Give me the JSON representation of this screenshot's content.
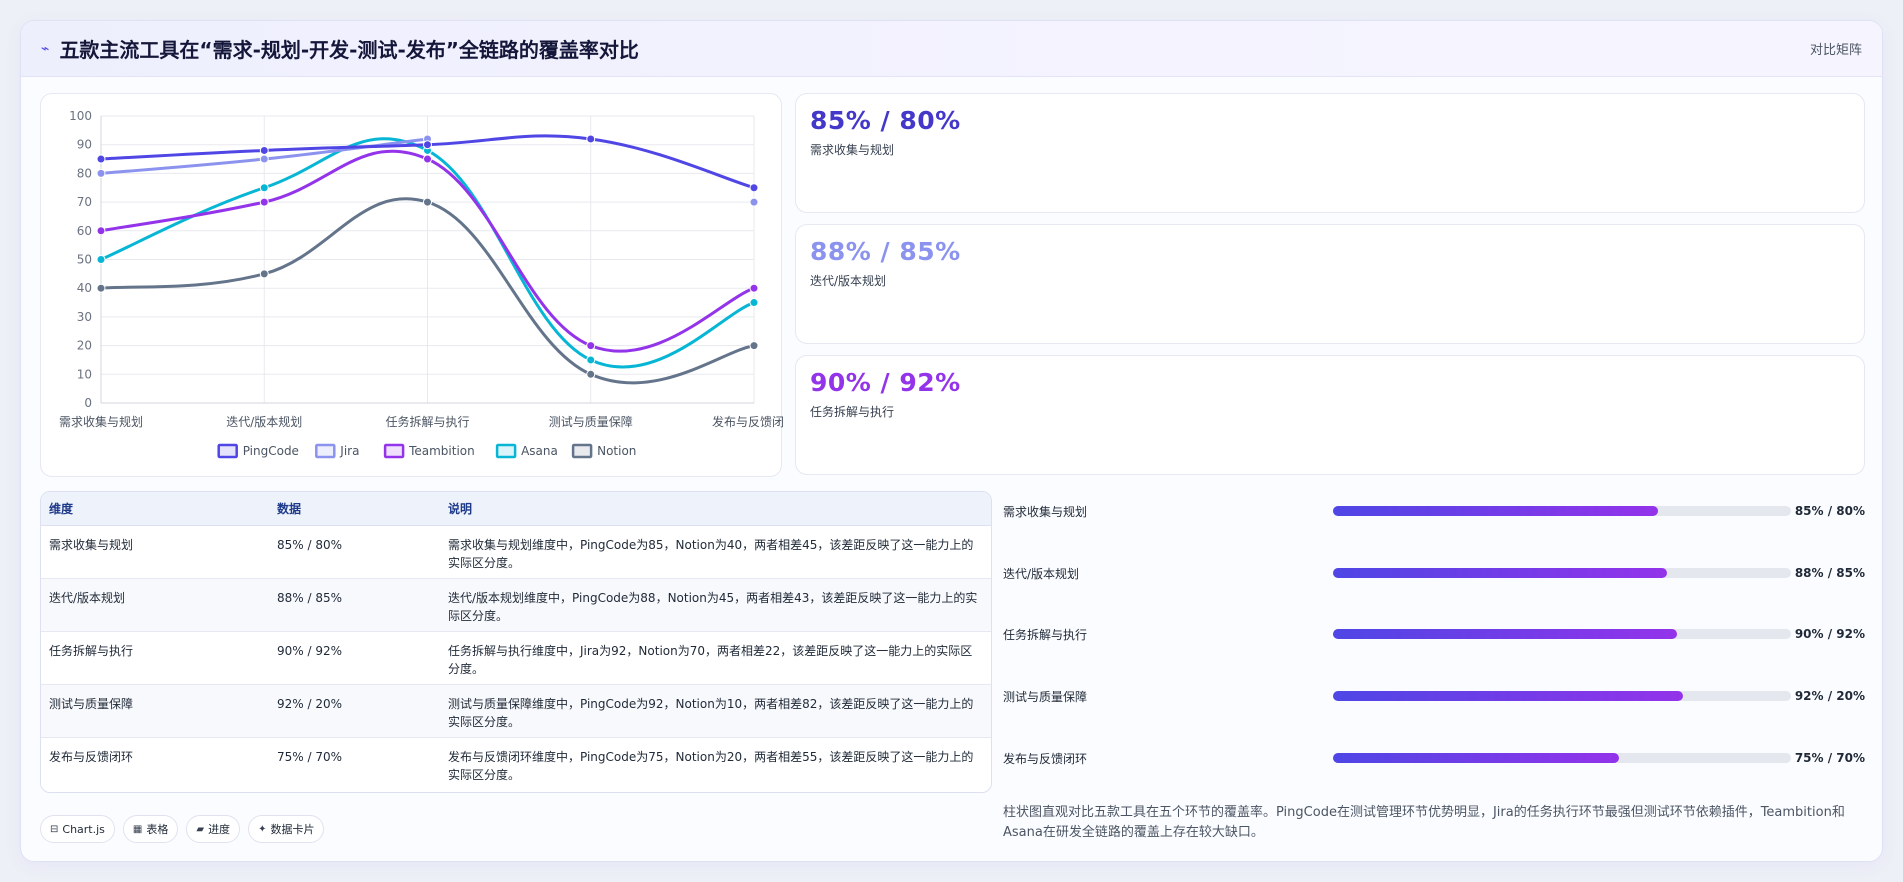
{
  "header": {
    "icon": "chart-line-icon",
    "title": "五款主流工具在“需求-规划-开发-测试-发布”全链路的覆盖率对比",
    "right_label": "对比矩阵"
  },
  "chart_data": {
    "type": "line",
    "categories": [
      "需求收集与规划",
      "迭代/版本规划",
      "任务拆解与执行",
      "测试与质量保障",
      "发布与反馈闭环"
    ],
    "series": [
      {
        "name": "PingCode",
        "values": [
          85,
          88,
          90,
          92,
          75
        ],
        "color": "#4f46e5"
      },
      {
        "name": "Jira",
        "values": [
          80,
          85,
          92,
          null,
          70
        ],
        "color": "#8b93ee"
      },
      {
        "name": "Teambition",
        "values": [
          60,
          70,
          85,
          20,
          40
        ],
        "color": "#9333ea"
      },
      {
        "name": "Asana",
        "values": [
          50,
          75,
          88,
          15,
          35
        ],
        "color": "#06b6d4"
      },
      {
        "name": "Notion",
        "values": [
          40,
          45,
          70,
          10,
          20
        ],
        "color": "#64748b"
      }
    ],
    "ylim": [
      0,
      100
    ],
    "yticks": [
      0,
      10,
      20,
      30,
      40,
      50,
      60,
      70,
      80,
      90,
      100
    ],
    "grid": true,
    "legend": "bottom"
  },
  "stats": [
    {
      "value": "85% / 80%",
      "label": "需求收集与规划",
      "color": "#4338ca"
    },
    {
      "value": "88% / 85%",
      "label": "迭代/版本规划",
      "color": "#8b93ee"
    },
    {
      "value": "90% / 92%",
      "label": "任务拆解与执行",
      "color": "#9333ea"
    }
  ],
  "table": {
    "headers": [
      "维度",
      "数据",
      "说明"
    ],
    "rows": [
      {
        "dim": "需求收集与规划",
        "data": "85% / 80%",
        "desc": "需求收集与规划维度中，PingCode为85，Notion为40，两者相差45，该差距反映了这一能力上的实际区分度。"
      },
      {
        "dim": "迭代/版本规划",
        "data": "88% / 85%",
        "desc": "迭代/版本规划维度中，PingCode为88，Notion为45，两者相差43，该差距反映了这一能力上的实际区分度。"
      },
      {
        "dim": "任务拆解与执行",
        "data": "90% / 92%",
        "desc": "任务拆解与执行维度中，Jira为92，Notion为70，两者相差22，该差距反映了这一能力上的实际区分度。"
      },
      {
        "dim": "测试与质量保障",
        "data": "92% / 20%",
        "desc": "测试与质量保障维度中，PingCode为92，Notion为10，两者相差82，该差距反映了这一能力上的实际区分度。"
      },
      {
        "dim": "发布与反馈闭环",
        "data": "75% / 70%",
        "desc": "发布与反馈闭环维度中，PingCode为75，Notion为20，两者相差55，该差距反映了这一能力上的实际区分度。"
      }
    ]
  },
  "progress": [
    {
      "label": "需求收集与规划",
      "value": "85% / 80%",
      "fill": 0.71
    },
    {
      "label": "迭代/版本规划",
      "value": "88% / 85%",
      "fill": 0.73
    },
    {
      "label": "任务拆解与执行",
      "value": "90% / 92%",
      "fill": 0.75
    },
    {
      "label": "测试与质量保障",
      "value": "92% / 20%",
      "fill": 0.765
    },
    {
      "label": "发布与反馈闭环",
      "value": "75% / 70%",
      "fill": 0.625
    }
  ],
  "pills": [
    {
      "icon": "chart-icon",
      "glyph": "⊟",
      "label": "Chart.js"
    },
    {
      "icon": "table-icon",
      "glyph": "▦",
      "label": "表格"
    },
    {
      "icon": "progress-icon",
      "glyph": "▰",
      "label": "进度"
    },
    {
      "icon": "sparkle-icon",
      "glyph": "✦",
      "label": "数据卡片"
    }
  ],
  "summary": "柱状图直观对比五款工具在五个环节的覆盖率。PingCode在测试管理环节优势明显，Jira的任务执行环节最强但测试环节依赖插件，Teambition和Asana在研发全链路的覆盖上存在较大缺口。"
}
